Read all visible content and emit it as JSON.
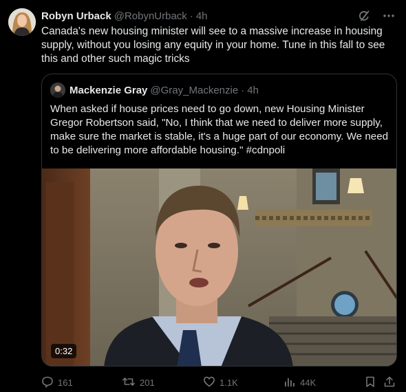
{
  "tweet": {
    "author_name": "Robyn Urback",
    "author_handle": "@RobynUrback",
    "separator": "·",
    "time": "4h",
    "text": "Canada's new housing minister will see to a massive increase in housing supply, without you losing any equity in your home. Tune in this fall to see this and other such magic tricks"
  },
  "quote": {
    "author_name": "Mackenzie Gray",
    "author_handle": "@Gray_Mackenzie",
    "separator": "·",
    "time": "4h",
    "text": "When asked if house prices need to go down, new Housing Minister Gregor Robertson said, \"No, I think that we need to deliver more supply, make sure the market is stable, it's a huge part of our economy. We need to be delivering more affordable housing.\" #cdnpoli",
    "video_duration": "0:32"
  },
  "actions": {
    "replies": "161",
    "reposts": "201",
    "likes": "1.1K",
    "views": "44K"
  },
  "icons": {
    "grok": "grok-icon",
    "more": "more-icon",
    "reply": "reply-icon",
    "repost": "repost-icon",
    "like": "like-icon",
    "views": "views-icon",
    "bookmark": "bookmark-icon",
    "share": "share-icon"
  },
  "colors": {
    "background": "#000000",
    "text_primary": "#e7e9ea",
    "text_secondary": "#71767b",
    "border": "#2f3336"
  }
}
